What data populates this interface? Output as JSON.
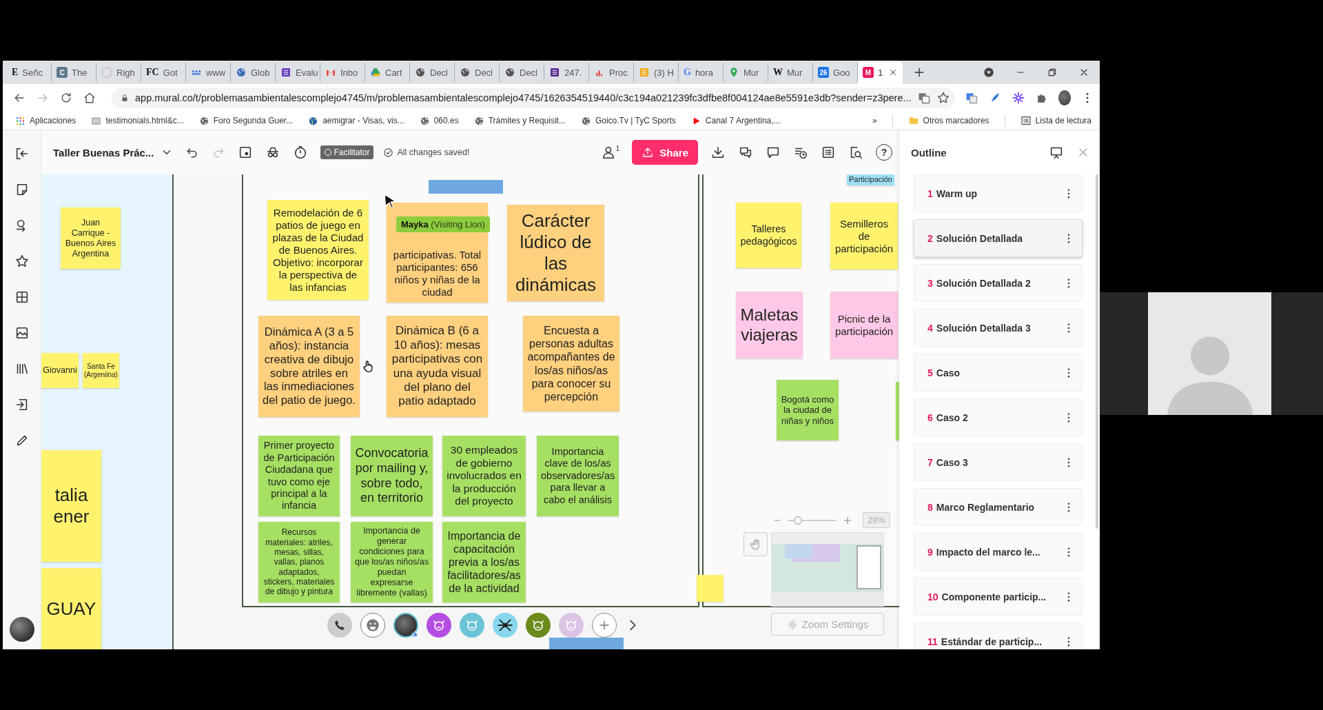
{
  "browser": {
    "tabs": [
      {
        "label": "Señc",
        "icon": {
          "kind": "letter",
          "text": "E"
        },
        "selected": false
      },
      {
        "label": "The",
        "icon": {
          "kind": "badge",
          "text": "C",
          "color": "#5f7a8c"
        },
        "selected": false
      },
      {
        "label": "Righ",
        "icon": {
          "kind": "ring",
          "color": "#cccccc"
        },
        "selected": false
      },
      {
        "label": "Got",
        "icon": {
          "kind": "letter",
          "text": "FC"
        },
        "selected": false
      },
      {
        "label": "www",
        "icon": {
          "kind": "dots",
          "color": "#3a6fd8"
        },
        "selected": false
      },
      {
        "label": "Glob",
        "icon": {
          "kind": "globe",
          "color": "#3b6fb5"
        },
        "selected": false
      },
      {
        "label": "Evalu",
        "icon": {
          "kind": "square",
          "color": "#673ab7"
        },
        "selected": false
      },
      {
        "label": "Inbo",
        "icon": {
          "kind": "mail",
          "color": "#ea4335"
        },
        "selected": false
      },
      {
        "label": "Cart",
        "icon": {
          "kind": "triangle",
          "color": "#34a853"
        },
        "selected": false
      },
      {
        "label": "Decl",
        "icon": {
          "kind": "globe",
          "color": "#555555"
        },
        "selected": false
      },
      {
        "label": "Decl",
        "icon": {
          "kind": "globe",
          "color": "#555555"
        },
        "selected": false
      },
      {
        "label": "Decl",
        "icon": {
          "kind": "globe",
          "color": "#555555"
        },
        "selected": false
      },
      {
        "label": "247.",
        "icon": {
          "kind": "square",
          "color": "#5b2a91"
        },
        "selected": false
      },
      {
        "label": "Proc",
        "icon": {
          "kind": "bars",
          "color": "#e53935"
        },
        "selected": false
      },
      {
        "label": "(3) H",
        "icon": {
          "kind": "square",
          "color": "#f0a81c"
        },
        "selected": false
      },
      {
        "label": "hora",
        "icon": {
          "kind": "letter",
          "text": "G",
          "color": "#4285f4"
        },
        "selected": false
      },
      {
        "label": "Mur",
        "icon": {
          "kind": "pin",
          "color": "#34a853"
        },
        "selected": false
      },
      {
        "label": "Mur",
        "icon": {
          "kind": "letter",
          "text": "W"
        },
        "selected": false
      },
      {
        "label": "Goo",
        "icon": {
          "kind": "badge",
          "text": "26",
          "color": "#1a73e8"
        },
        "selected": false
      },
      {
        "label": "1",
        "icon": {
          "kind": "badge",
          "text": "M",
          "color": "#e8175d"
        },
        "selected": true
      }
    ],
    "address": "app.mural.co/t/problemasambientalescomplejo4745/m/problemasambientalescomplejo4745/1626354519440/c3c194a021239fc3dfbe8f004124ae8e5591e3db?sender=z3pere...",
    "bookmarks": [
      {
        "label": "Aplicaciones",
        "kind": "apps"
      },
      {
        "label": "testimonials.html&c...",
        "kind": "page"
      },
      {
        "label": "Foro Segunda Guer...",
        "kind": "globe"
      },
      {
        "label": "aemigrar - Visas, vis...",
        "kind": "earth"
      },
      {
        "label": "060.es",
        "kind": "globe"
      },
      {
        "label": "Trámites y Requisit...",
        "kind": "globe"
      },
      {
        "label": "Goico.Tv | TyC Sports",
        "kind": "globe"
      },
      {
        "label": "Canal 7 Argentina,...",
        "kind": "play"
      }
    ],
    "more_bookmarks": "»",
    "other_bookmarks": "Otros marcadores",
    "reading_list": "Lista de lectura"
  },
  "mural": {
    "title": "Taller Buenas Prác...",
    "facilitator": "Facilitator",
    "save_status": "All changes saved!",
    "member_count": "1",
    "share": "Share",
    "help": "?",
    "canvas": {
      "side_notes": [
        {
          "text": "Juan Carrique - Buenos Aires Argentina",
          "color": "#fff36e"
        },
        {
          "text": "Giovanni",
          "color": "#fff36e"
        },
        {
          "text": "Santa Fe (Argeniina)",
          "color": "#fff36e"
        },
        {
          "text": "talia\nener",
          "color": "#fff36e"
        },
        {
          "text": "GUAY",
          "color": "#fff36e"
        }
      ],
      "board_notes": [
        {
          "text": "Remodelación de 6 patios de juego en plazas de la Ciudad de Buenos Aires. Objetivo: incorporar la perspectiva de las infancias",
          "color": "#fff36e"
        },
        {
          "text": "participativas. Total participantes: 656 niños y niñas de la ciudad",
          "color": "#ffd07e"
        },
        {
          "text": "Carácter lúdico de las dinámicas",
          "color": "#ffd07e"
        },
        {
          "text": "Dinámica A (3 a 5 años): instancia creativa de dibujo sobre atriles en las inmediaciones del patio de juego.",
          "color": "#ffd07e"
        },
        {
          "text": "Dinámica B (6 a 10 años): mesas participativas con una ayuda visual del plano del patio adaptado",
          "color": "#ffd07e"
        },
        {
          "text": "Encuesta a personas adultas acompañantes de los/as niños/as para conocer su percepción",
          "color": "#ffd07e"
        },
        {
          "text": "Primer proyecto de Participación Ciudadana que tuvo como eje principal a la infancia",
          "color": "#a6e063"
        },
        {
          "text": "Convocatoria por mailing y, sobre todo, en territorio",
          "color": "#a6e063"
        },
        {
          "text": "30 empleados de gobierno involucrados en la producción del proyecto",
          "color": "#a6e063"
        },
        {
          "text": "Importancia clave de los/as observadores/as para llevar a cabo el análisis",
          "color": "#a6e063"
        },
        {
          "text": "Recursos materiales: atriles, mesas, sillas, vallas, planos adaptados, stickers, materiales de dibujo y pintura",
          "color": "#a6e063"
        },
        {
          "text": "Importancia de generar condiciones para que los/as niños/as puedan expresarse libremente (vallas)",
          "color": "#a6e063"
        },
        {
          "text": "Importancia de capacitación previa a los/as facilitadores/as de la actividad",
          "color": "#a6e063"
        }
      ],
      "right_notes": [
        {
          "text": "Participación",
          "color": "#9fe0f5"
        },
        {
          "text": "Talleres pedagógicos",
          "color": "#fff36e"
        },
        {
          "text": "Semilleros de participación",
          "color": "#fff36e"
        },
        {
          "text": "Maletas viajeras",
          "color": "#ffc8e6"
        },
        {
          "text": "Picnic de la participación",
          "color": "#ffc8e6"
        },
        {
          "text": "Bogotá como la ciudad de niñas y niños",
          "color": "#a6e063"
        }
      ],
      "shapes": [
        {
          "kind": "rect",
          "color": "#6fa8e0"
        },
        {
          "kind": "note",
          "color": "#fff36e"
        },
        {
          "kind": "rect",
          "color": "#6fa8e0"
        },
        {
          "kind": "note",
          "color": "#a6e063"
        }
      ],
      "cursor_label": "**Mayka** (Visiting Lion)",
      "collaborators": [
        {
          "kind": "phone"
        },
        {
          "kind": "emoji"
        },
        {
          "kind": "photo"
        },
        {
          "kind": "animal",
          "color": "#b44ee2"
        },
        {
          "kind": "animal",
          "color": "#6cc4d6"
        },
        {
          "kind": "spider",
          "color": "#86d6ee"
        },
        {
          "kind": "animal",
          "color": "#6a8a1c"
        },
        {
          "kind": "animal",
          "color": "#dcc4e6"
        },
        {
          "kind": "add"
        },
        {
          "kind": "more"
        }
      ],
      "zoom": {
        "level": 0.2,
        "reading": "28%",
        "settings": "Zoom Settings"
      }
    },
    "outline": {
      "title": "Outline",
      "items": [
        {
          "number": "1",
          "title": "Warm up",
          "selected": false
        },
        {
          "number": "2",
          "title": "Solución Detallada",
          "selected": true
        },
        {
          "number": "3",
          "title": "Solución Detallada 2",
          "selected": false
        },
        {
          "number": "4",
          "title": "Solución Detallada 3",
          "selected": false
        },
        {
          "number": "5",
          "title": "Caso",
          "selected": false
        },
        {
          "number": "6",
          "title": "Caso 2",
          "selected": false
        },
        {
          "number": "7",
          "title": "Caso 3",
          "selected": false
        },
        {
          "number": "8",
          "title": "Marco Reglamentario",
          "selected": false
        },
        {
          "number": "9",
          "title": "Impacto del marco le...",
          "selected": false
        },
        {
          "number": "10",
          "title": "Componente particip...",
          "selected": false
        },
        {
          "number": "11",
          "title": "Estándar de particip...",
          "selected": false
        }
      ]
    }
  }
}
